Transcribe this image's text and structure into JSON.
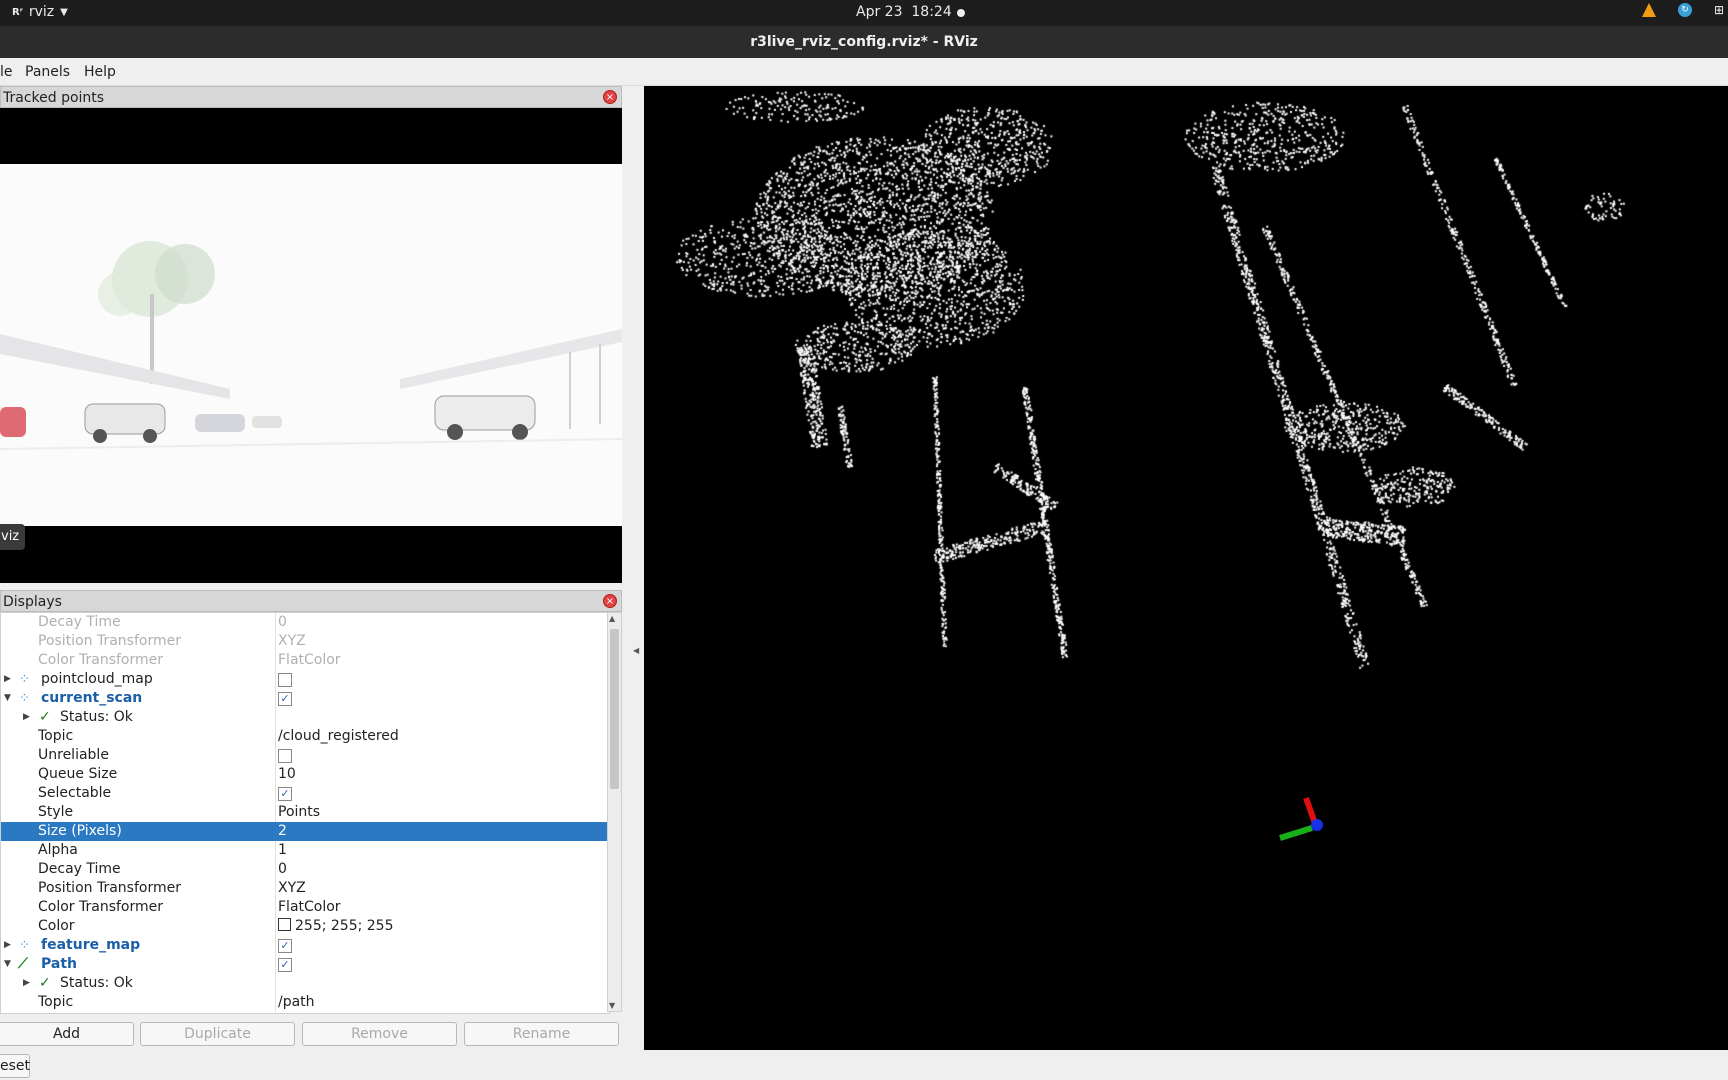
{
  "topbar": {
    "app_name": "rviz",
    "app_logo": "Rʳ",
    "date": "Apr 23",
    "time": "18:24"
  },
  "window": {
    "title": "r3live_rviz_config.rviz* - RViz"
  },
  "menu": {
    "file": "le",
    "panels": "Panels",
    "help": "Help"
  },
  "camera_panel": {
    "title": "Tracked points",
    "overlay_tag": "viz"
  },
  "displays": {
    "title": "Displays",
    "rows": [
      {
        "label": "Decay Time",
        "value": "0"
      },
      {
        "label": "Position Transformer",
        "value": "XYZ"
      },
      {
        "label": "Color Transformer",
        "value": "FlatColor"
      },
      {
        "label": "pointcloud_map",
        "checked": false
      },
      {
        "label": "current_scan",
        "checked": true
      },
      {
        "label": "Status: Ok"
      },
      {
        "label": "Topic",
        "value": "/cloud_registered"
      },
      {
        "label": "Unreliable",
        "checked": false
      },
      {
        "label": "Queue Size",
        "value": "10"
      },
      {
        "label": "Selectable",
        "checked": true
      },
      {
        "label": "Style",
        "value": "Points"
      },
      {
        "label": "Size (Pixels)",
        "value": "2"
      },
      {
        "label": "Alpha",
        "value": "1"
      },
      {
        "label": "Decay Time",
        "value": "0"
      },
      {
        "label": "Position Transformer",
        "value": "XYZ"
      },
      {
        "label": "Color Transformer",
        "value": "FlatColor"
      },
      {
        "label": "Color",
        "value": "255; 255; 255"
      },
      {
        "label": "feature_map",
        "checked": true
      },
      {
        "label": "Path",
        "checked": true
      },
      {
        "label": "Status: Ok"
      },
      {
        "label": "Topic",
        "value": "/path"
      }
    ]
  },
  "buttons": {
    "add": "Add",
    "duplicate": "Duplicate",
    "remove": "Remove",
    "rename": "Rename",
    "reset": "eset"
  },
  "colors": {
    "selection": "#2b79c2",
    "accent_blue": "#1b5ea8",
    "ok_green": "#1a7a1a",
    "background_3d": "#000000"
  }
}
